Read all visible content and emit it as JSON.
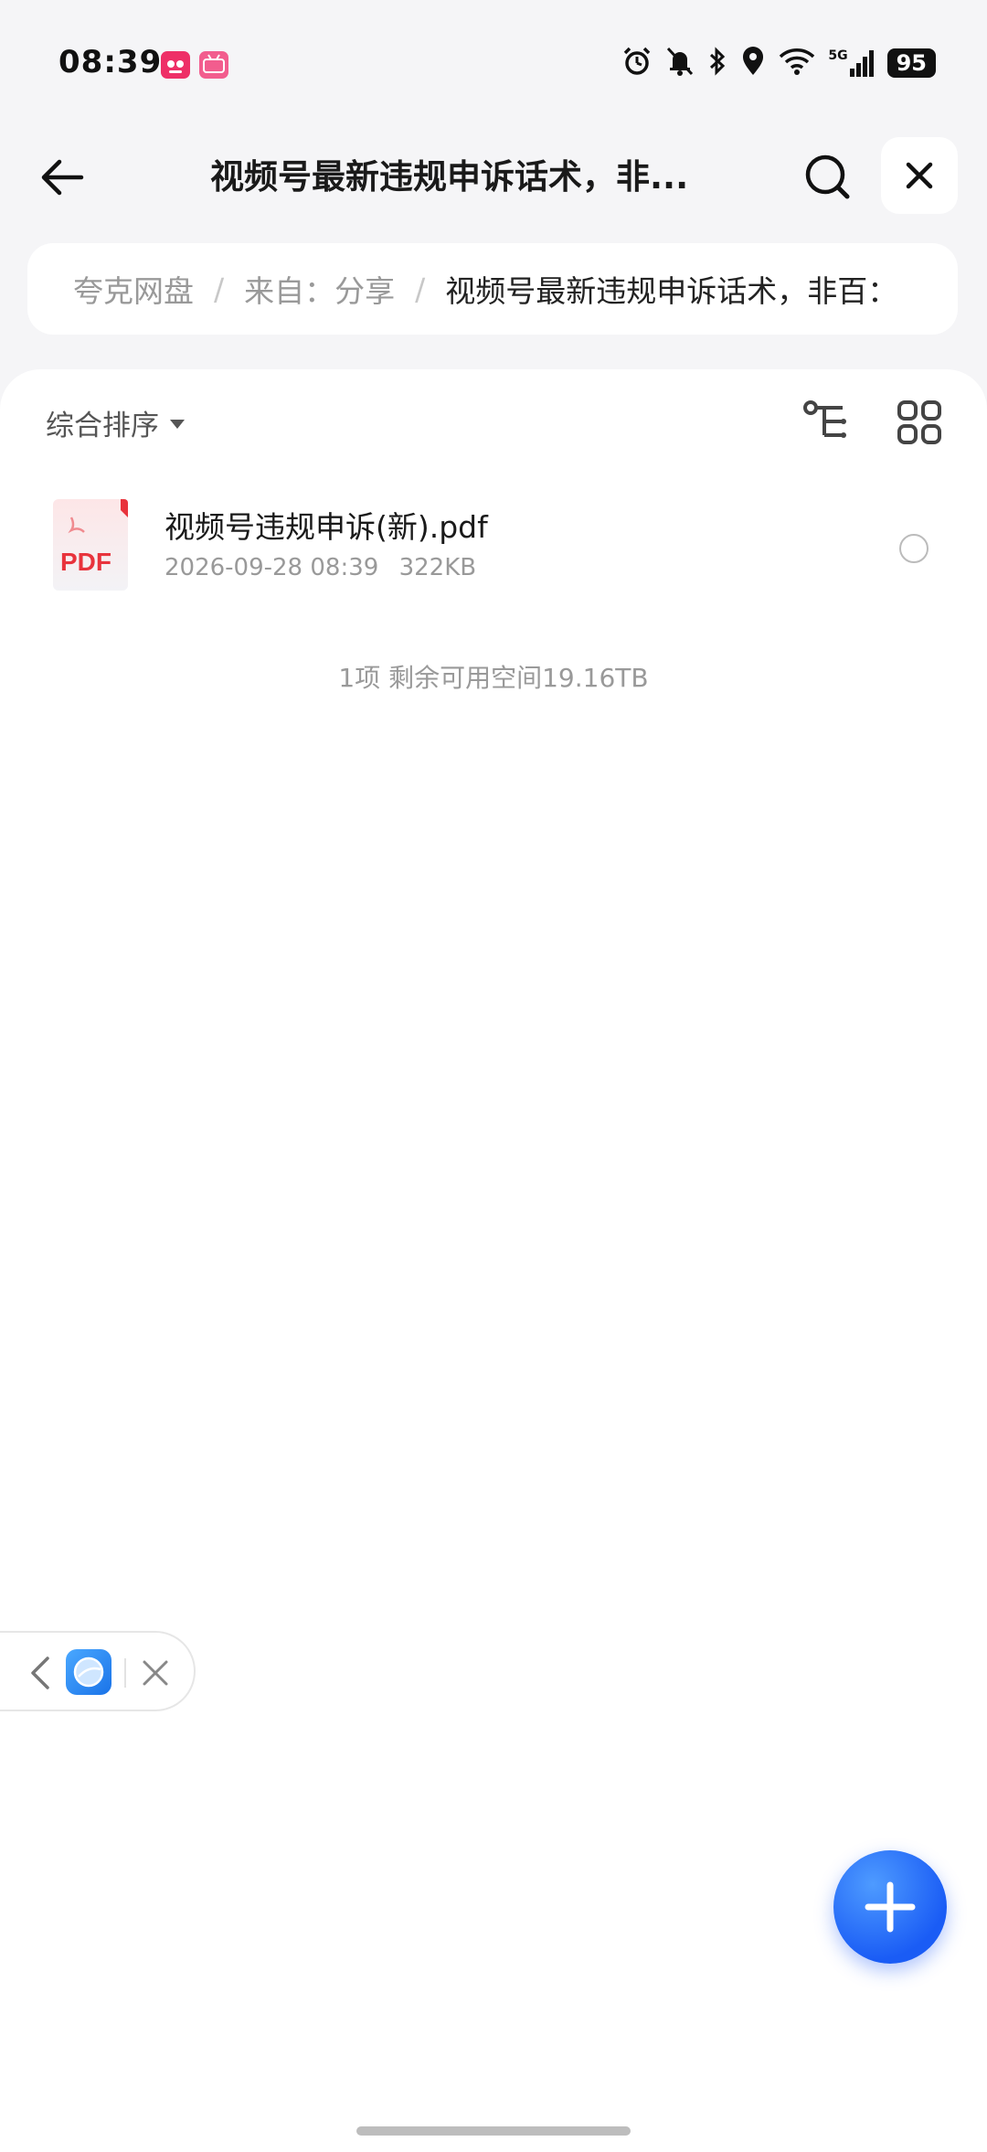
{
  "status_bar": {
    "time": "08:39",
    "network": "5G",
    "battery": "95"
  },
  "header": {
    "title": "视频号最新违规申诉话术，非..."
  },
  "breadcrumb": {
    "items": [
      "夸克网盘",
      "来自：分享",
      "视频号最新违规申诉话术，非百："
    ],
    "separator": "/"
  },
  "toolbar": {
    "sort_label": "综合排序"
  },
  "files": [
    {
      "name": "视频号违规申诉(新).pdf",
      "date": "2026-09-28 08:39",
      "size": "322KB",
      "type_label": "PDF"
    }
  ],
  "summary": "1项 剩余可用空间19.16TB",
  "colors": {
    "accent": "#1a5cf5",
    "pdf_red": "#e8333c",
    "background": "#f5f5f7"
  },
  "icons": {
    "back": "arrow-left-icon",
    "search": "search-icon",
    "close": "close-icon",
    "tree": "tree-view-icon",
    "grid": "grid-view-icon",
    "add": "plus-icon"
  }
}
